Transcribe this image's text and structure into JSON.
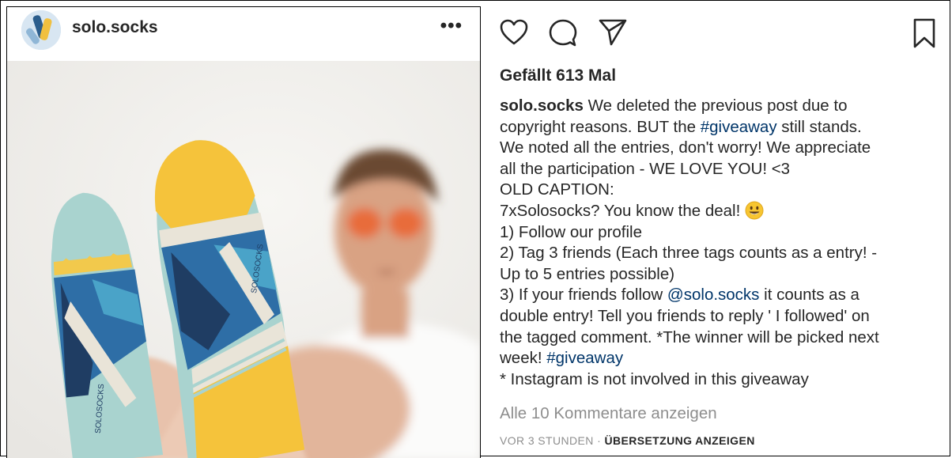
{
  "post": {
    "username": "solo.socks",
    "more_label": "•••",
    "likes_text": "Gefällt 613 Mal",
    "caption": {
      "l1_text": " We deleted the previous post due to",
      "l2_text": "copyright reasons. BUT the ",
      "l2_tag": "#giveaway",
      "l2_tail": " still stands.",
      "l3": "We noted all the entries, don't worry! We appreciate",
      "l4": "all the participation - WE LOVE YOU! <3",
      "l5": "OLD CAPTION:",
      "l6": "7xSolosocks? You know the deal! ",
      "l7": "1) Follow our profile",
      "l8": "2) Tag 3 friends (Each three tags counts as a entry! -",
      "l9": "Up to 5 entries possible)",
      "l10_text": "3) If your friends follow ",
      "l10_mention": "@solo.socks",
      "l10_tail": " it counts as a",
      "l11": "double entry! Tell you friends to reply ' I followed' on",
      "l12": "the tagged comment. *The winner will be picked next",
      "l13_text": "week! ",
      "l13_tag": "#giveaway",
      "l14": "* Instagram is not involved in this giveaway"
    },
    "view_comments": "Alle 10 Kommentare anzeigen",
    "timestamp": "VOR 3 STUNDEN",
    "separator": " · ",
    "translate": "ÜBERSETZUNG ANZEIGEN"
  },
  "icons": [
    "heart-icon",
    "comment-icon",
    "share-icon",
    "bookmark-icon",
    "smiley-emoji-icon",
    "ellipsis-icon"
  ],
  "colors": {
    "text": "#262626",
    "link": "#003569",
    "muted": "#8e8e8e",
    "sock_yellow": "#f5c33b",
    "sock_mint": "#a9d3cf"
  }
}
